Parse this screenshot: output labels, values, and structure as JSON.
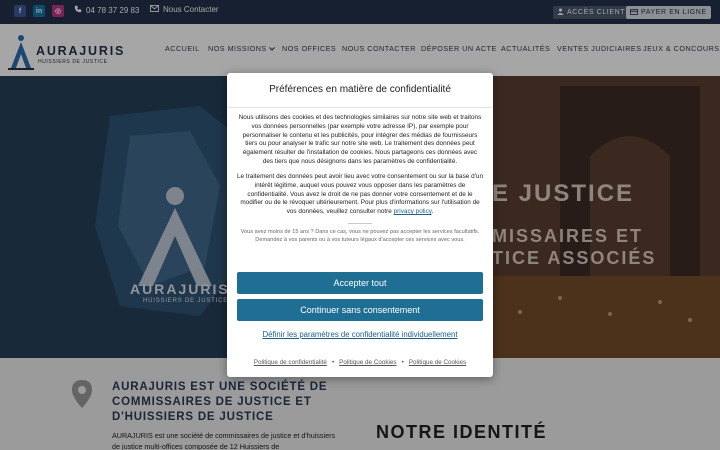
{
  "topbar": {
    "social": [
      {
        "name": "facebook-icon",
        "glyph": "f",
        "color": "#3b5998"
      },
      {
        "name": "linkedin-icon",
        "glyph": "in",
        "color": "#0e76a8"
      },
      {
        "name": "instagram-icon",
        "glyph": "◎",
        "color": "#c13584"
      }
    ],
    "phone": "04 78 37 29 83",
    "contact": "Nous Contacter",
    "client_access": "ACCÈS CLIENT",
    "pay_online": "PAYER EN LIGNE"
  },
  "brand": {
    "name": "AURAJURIS",
    "tagline": "HUISSIERS DE JUSTICE"
  },
  "nav": {
    "home": "ACCUEIL",
    "missions": "NOS MISSIONS",
    "offices": "NOS OFFICES",
    "contact": "NOUS CONTACTER",
    "file_act": "DÉPOSER UN ACTE",
    "news": "ACTUALITÉS",
    "sales": "VENTES JUDICIAIRES",
    "games": "JEUX & CONCOURS"
  },
  "hero": {
    "line1": "E JUSTICE",
    "line2": "MISSAIRES ET",
    "line3": "TICE ASSOCIÉS",
    "logo_name": "AURAJURIS",
    "logo_tagline": "HUISSIERS DE JUSTICE"
  },
  "consent": {
    "title": "Préférences en matière de confidentialité",
    "paragraph1": "Nous utilisons des cookies et des technologies similaires sur notre site web et traitons vos données personnelles (par exemple votre adresse IP), par exemple pour personnaliser le contenu et les publicités, pour intégrer des médias de fournisseurs tiers ou pour analyser le trafic sur notre site web. Le traitement des données peut également résulter de l'installation de cookies. Nous partageons ces données avec des tiers que nous désignons dans les paramètres de confidentialité.",
    "paragraph2": "Le traitement des données peut avoir lieu avec votre consentement ou sur la base d'un intérêt légitime, auquel vous pouvez vous opposer dans les paramètres de confidentialité. Vous avez le droit de ne pas donner votre consentement et de le modifier ou de le révoquer ultérieurement. Pour plus d'informations sur l'utilisation de vos données, veuillez consulter notre",
    "privacy_link": "privacy policy",
    "paragraph2_end": ".",
    "minor_notice": "Vous avez moins de 15 ans ? Dans ce cas, vous ne pouvez pas accepter les services facultatifs. Demandez à vos parents ou à vos tuteurs légaux d'accepter ces services avec vous.",
    "accept_all": "Accepter tout",
    "continue_without": "Continuer sans consentement",
    "customize": "Définir les paramètres de confidentialité individuellement",
    "footer": [
      "Politique de confidentialité",
      "Politique de Cookies",
      "Politique de Cookies"
    ]
  },
  "about": {
    "title": "AURAJURIS EST UNE SOCIÉTÉ DE COMMISSAIRES DE JUSTICE ET D'HUISSIERS DE JUSTICE",
    "text": "AURAJURIS est une société de commissaires de justice et d'huissiers de justice multi-offices composée de 12 Huissiers de",
    "identity_heading": "NOTRE IDENTITÉ"
  }
}
